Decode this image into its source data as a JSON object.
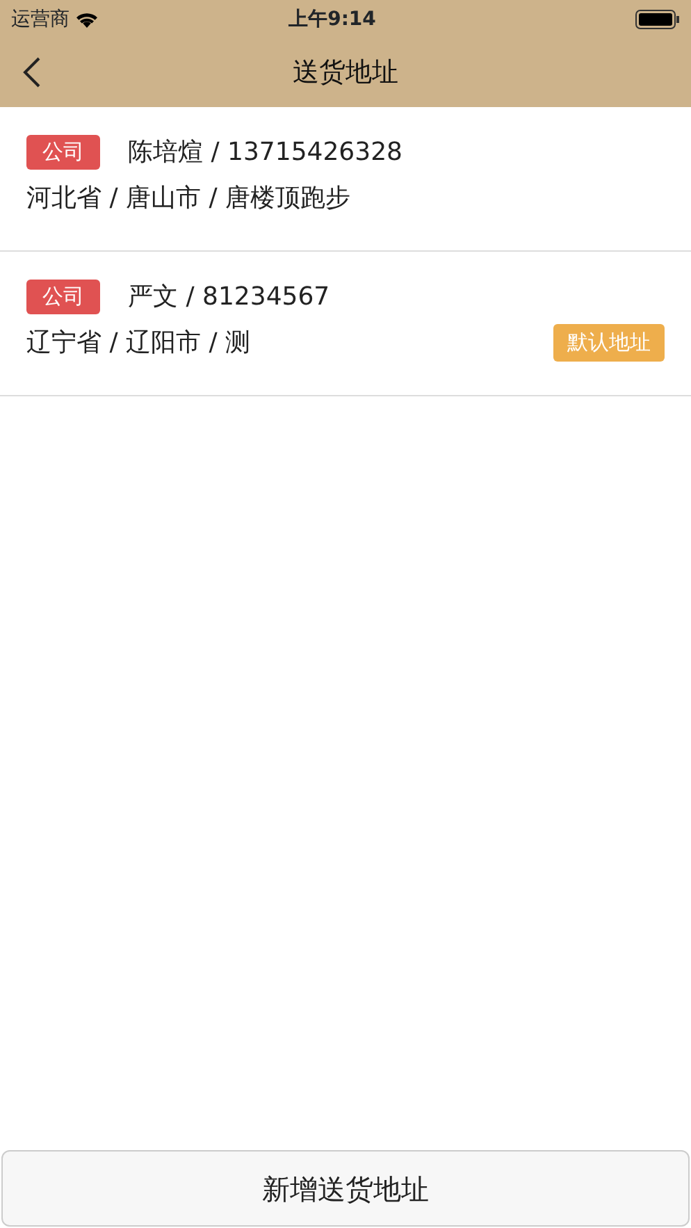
{
  "status_bar": {
    "carrier": "运营商",
    "time": "上午9:14"
  },
  "nav_bar": {
    "title": "送货地址"
  },
  "addresses": [
    {
      "tag": "公司",
      "contact": "陈培煊 / 13715426328",
      "address": "河北省 / 唐山市 / 唐楼顶跑步"
    },
    {
      "tag": "公司",
      "contact": "严文 / 81234567",
      "address": "辽宁省 / 辽阳市 / 测",
      "badge": "默认地址"
    }
  ],
  "add_button": "新增送货地址"
}
